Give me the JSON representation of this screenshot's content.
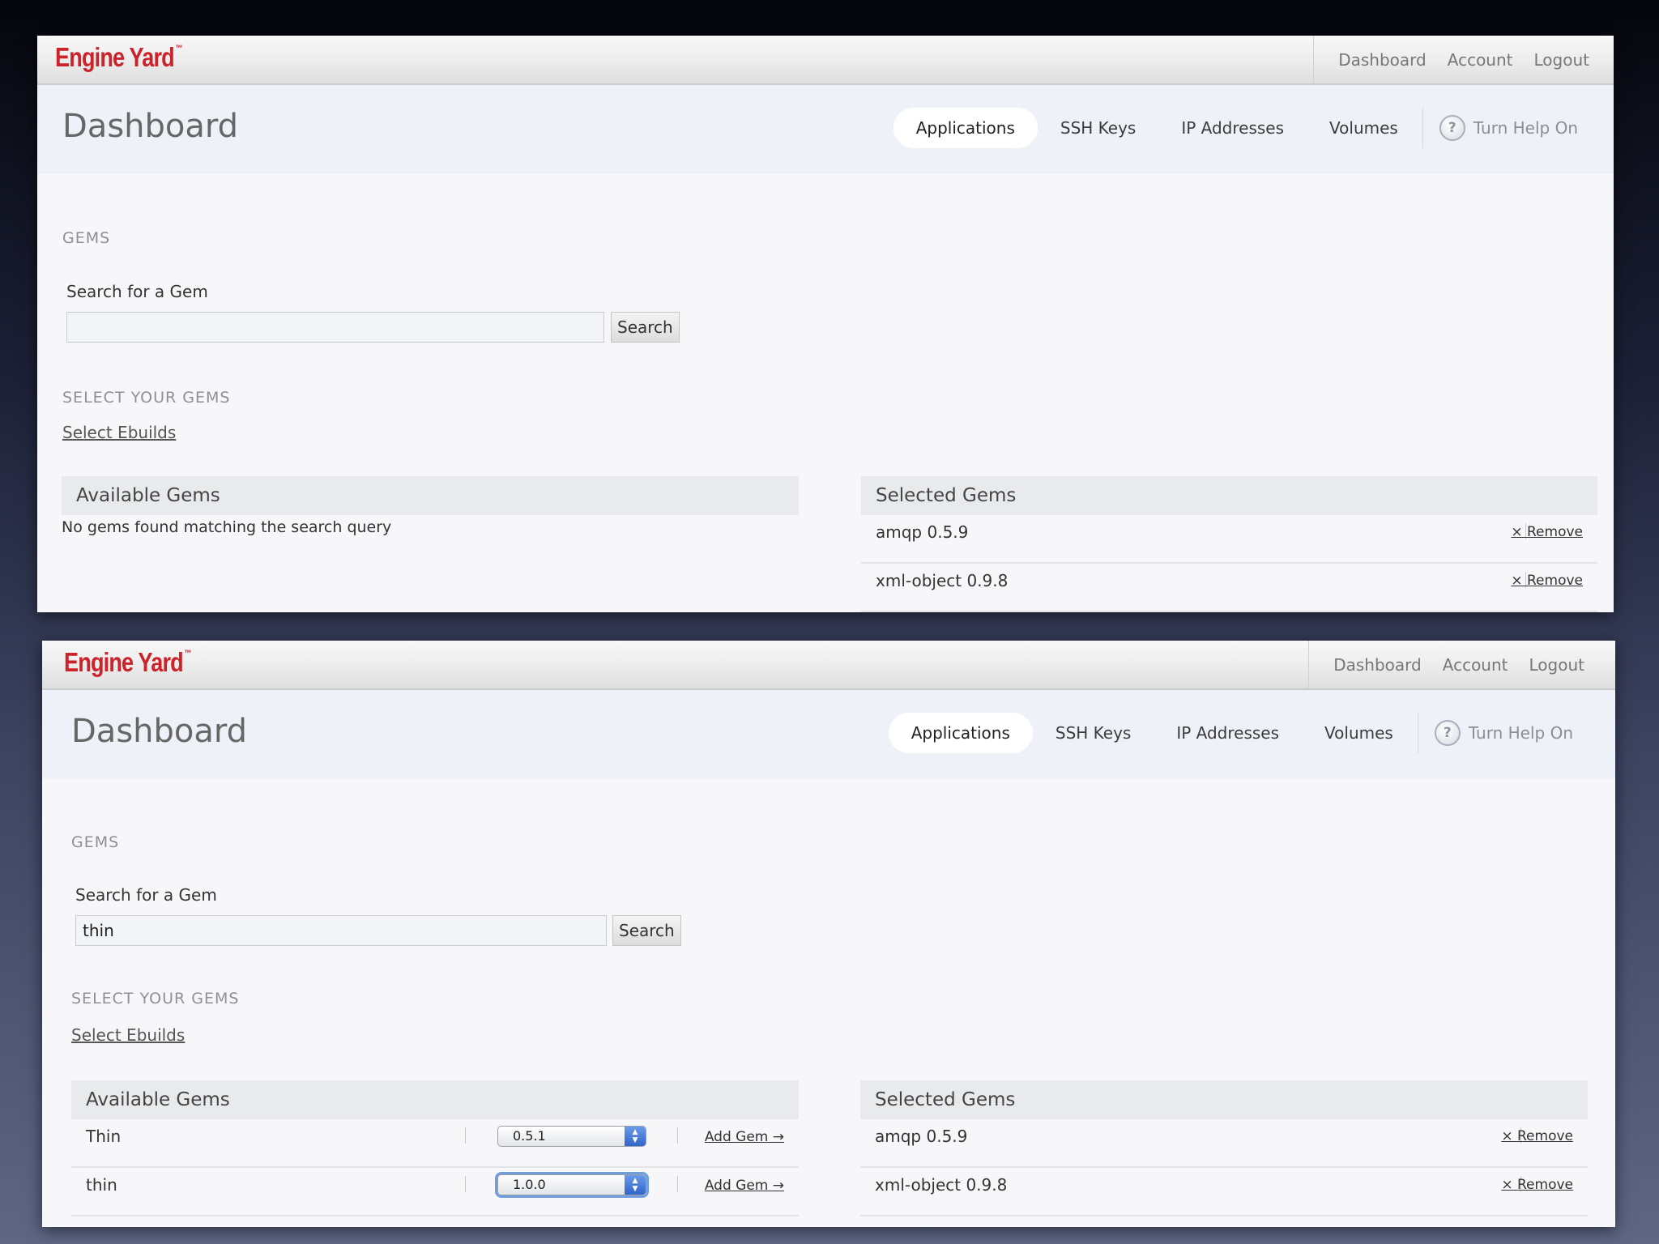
{
  "brand": {
    "logo": "Engine Yard",
    "tm": "™"
  },
  "top_nav": [
    "Dashboard",
    "Account",
    "Logout"
  ],
  "page_title": "Dashboard",
  "tabs": [
    "Applications",
    "SSH Keys",
    "IP Addresses",
    "Volumes"
  ],
  "help_label": "Turn Help On",
  "help_icon": "?",
  "gems_heading": "GEMS",
  "search_label": "Search for a Gem",
  "search_button": "Search",
  "select_heading": "SELECT YOUR GEMS",
  "select_ebuilds_link": "Select Ebuilds",
  "available_header": "Available Gems",
  "selected_header": "Selected Gems",
  "remove_label": "× Remove",
  "add_gem_label": "Add Gem →",
  "panel1": {
    "search_value": "",
    "available_message": "No gems found matching the search query",
    "selected": [
      {
        "name": "amqp 0.5.9"
      },
      {
        "name": "xml-object 0.9.8"
      }
    ]
  },
  "panel2": {
    "search_value": "thin",
    "available": [
      {
        "name": "Thin",
        "version": "0.5.1"
      },
      {
        "name": "thin",
        "version": "1.0.0"
      }
    ],
    "selected": [
      {
        "name": "amqp 0.5.9"
      },
      {
        "name": "xml-object 0.9.8"
      }
    ]
  },
  "colors": {
    "brand_red": "#cc2229",
    "active_tab_bg": "#ffffff",
    "focus_ring": "#6f9de0"
  }
}
